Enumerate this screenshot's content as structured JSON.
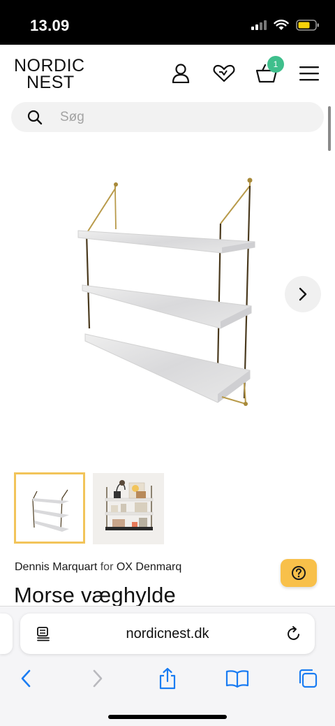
{
  "status_bar": {
    "time": "13.09"
  },
  "header": {
    "logo_line1": "NORDIC",
    "logo_line2": "NEST",
    "cart_count": "1"
  },
  "search": {
    "placeholder": "Søg"
  },
  "product": {
    "designer": "Dennis Marquart",
    "for_word": "for",
    "brand": "OX Denmarq",
    "title": "Morse væghylde"
  },
  "browser": {
    "url": "nordicnest.dk"
  },
  "colors": {
    "accent": "#f2c45a",
    "help_button": "#f8c04a",
    "cart_badge": "#3fbf8c",
    "safari_blue": "#1a7cf2"
  },
  "icons": {
    "account": "user-icon",
    "wishlist": "heart-icon",
    "cart": "basket-icon",
    "menu": "hamburger-icon",
    "search": "search-icon",
    "next": "chevron-right-icon",
    "help": "question-icon",
    "reader": "reader-icon",
    "reload": "reload-icon",
    "back": "chevron-left-icon",
    "forward": "chevron-right-icon",
    "share": "share-icon",
    "bookmarks": "book-icon",
    "tabs": "tabs-icon"
  }
}
